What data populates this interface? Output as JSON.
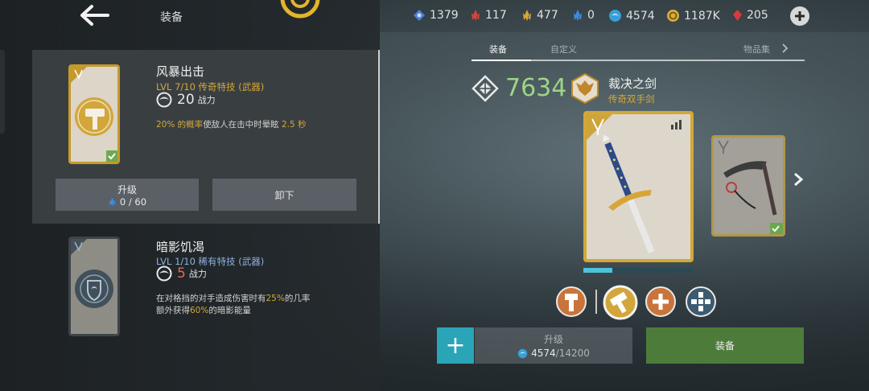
{
  "header": {
    "title": "装备",
    "resources": [
      {
        "icon": "blue-crystal-icon",
        "value": "1379",
        "color": "#4a7fe0"
      },
      {
        "icon": "red-shard-icon",
        "value": "117",
        "color": "#d8443a"
      },
      {
        "icon": "gold-shard-icon",
        "value": "477",
        "color": "#d7a636"
      },
      {
        "icon": "blue-shard-icon",
        "value": "0",
        "color": "#3a8fe0"
      },
      {
        "icon": "blue-orb-icon",
        "value": "4574",
        "color": "#3a9fd6"
      },
      {
        "icon": "gold-coin-icon",
        "value": "1187K",
        "color": "#d8ac3a"
      },
      {
        "icon": "red-gem-icon",
        "value": "205",
        "color": "#d83a3a"
      }
    ]
  },
  "skills": [
    {
      "name": "风暴出击",
      "level": "LVL  7/10  传奇特技 (武器)",
      "power": "20",
      "power_label": "战力",
      "desc_pre": "20% 的概率",
      "desc_mid": "使敌人在击中时晕眩 ",
      "desc_post": "2.5 秒",
      "upgrade_label": "升级",
      "upgrade_cost": "0 / 60",
      "unequip_label": "卸下"
    },
    {
      "name": "暗影饥渴",
      "level": "LVL  1/10  稀有特技 (武器)",
      "power": "5",
      "power_label": "战力",
      "desc_a": "在对格挡的对手造成伤害时有",
      "desc_b": "25%",
      "desc_c": "的几率",
      "desc_d": "额外获得",
      "desc_e": "60%",
      "desc_f": "的暗影能量"
    }
  ],
  "tabs": [
    {
      "label": "装备",
      "active": true
    },
    {
      "label": "自定义",
      "active": false
    },
    {
      "label": "物品集",
      "active": false
    }
  ],
  "weapon": {
    "power": "7634",
    "name": "裁决之剑",
    "type": "传奇双手剑",
    "progress": 0.26
  },
  "actions": {
    "plus": "+",
    "upgrade_label": "升级",
    "upgrade_current": "4574",
    "upgrade_sep": " / ",
    "upgrade_total": "14200",
    "equip_label": "装备"
  }
}
